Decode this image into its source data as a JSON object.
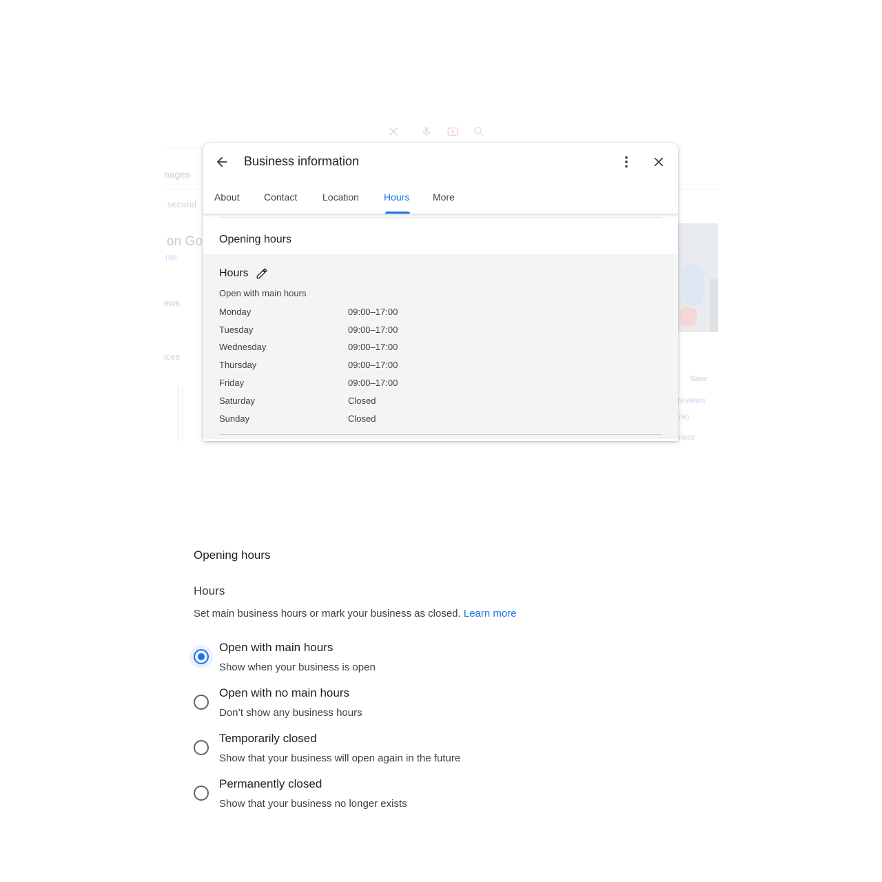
{
  "background_page": {
    "texts": [
      "nages",
      "second",
      "on Go",
      "ntn",
      "ews",
      "ices",
      "Save",
      "reviews",
      "nk)",
      "ness"
    ]
  },
  "dialog": {
    "title": "Business information",
    "back_icon": "arrow-back-icon",
    "more_icon": "more-vert-icon",
    "close_icon": "close-icon",
    "tabs": [
      {
        "label": "About"
      },
      {
        "label": "Contact"
      },
      {
        "label": "Location"
      },
      {
        "label": "Hours",
        "active": true
      },
      {
        "label": "More"
      }
    ],
    "section_title": "Opening hours",
    "hours": {
      "heading": "Hours",
      "edit_icon": "pencil-icon",
      "status": "Open with main hours",
      "schedule": [
        {
          "day": "Monday",
          "time": "09:00–17:00"
        },
        {
          "day": "Tuesday",
          "time": "09:00–17:00"
        },
        {
          "day": "Wednesday",
          "time": "09:00–17:00"
        },
        {
          "day": "Thursday",
          "time": "09:00–17:00"
        },
        {
          "day": "Friday",
          "time": "09:00–17:00"
        },
        {
          "day": "Saturday",
          "time": "Closed"
        },
        {
          "day": "Sunday",
          "time": "Closed"
        }
      ]
    }
  },
  "editor": {
    "title": "Opening hours",
    "hours_label": "Hours",
    "description": "Set main business hours or mark your business as closed.",
    "learn_more": "Learn more",
    "options": [
      {
        "label": "Open with main hours",
        "sub": "Show when your business is open",
        "selected": true
      },
      {
        "label": "Open with no main hours",
        "sub": "Don’t show any business hours",
        "selected": false
      },
      {
        "label": "Temporarily closed",
        "sub": "Show that your business will open again in the future",
        "selected": false
      },
      {
        "label": "Permanently closed",
        "sub": "Show that your business no longer exists",
        "selected": false
      }
    ]
  },
  "colors": {
    "accent": "#1a73e8",
    "panel_bg": "#f4f4f4",
    "text_primary": "#202124",
    "text_secondary": "#3c4043"
  }
}
